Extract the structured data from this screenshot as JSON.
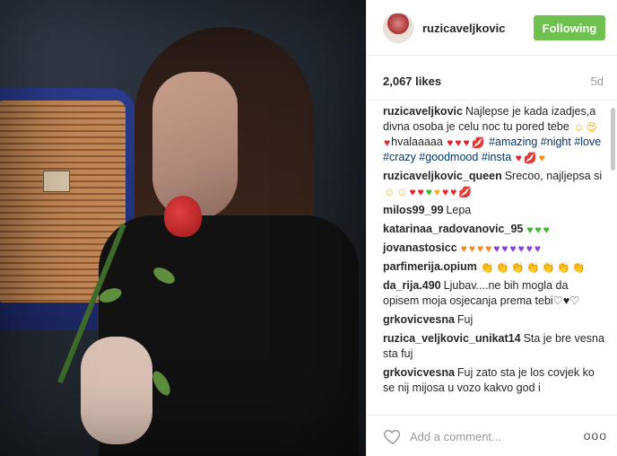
{
  "post": {
    "username": "ruzicaveljkovic",
    "follow_label": "Following",
    "likes": "2,067 likes",
    "age": "5d"
  },
  "comments": [
    {
      "user": "ruzicaveljkovic",
      "segments": [
        {
          "t": "text",
          "v": "Najlepse je kada izadjes,a divna osoba je celu noc tu pored tebe "
        },
        {
          "t": "emoji",
          "v": "☺",
          "c": "e-yellow"
        },
        {
          "t": "emoji",
          "v": "😍",
          "c": "e-yellow"
        },
        {
          "t": "emoji",
          "v": "♥",
          "c": "e-red"
        },
        {
          "t": "text",
          "v": "hvalaaaaa "
        },
        {
          "t": "emoji",
          "v": "♥",
          "c": "e-red"
        },
        {
          "t": "emoji",
          "v": "♥",
          "c": "e-red"
        },
        {
          "t": "emoji",
          "v": "♥",
          "c": "e-red"
        },
        {
          "t": "emoji",
          "v": "💋",
          "c": "e-red"
        },
        {
          "t": "tag",
          "v": " #amazing"
        },
        {
          "t": "tag",
          "v": " #night"
        },
        {
          "t": "tag",
          "v": " #love"
        },
        {
          "t": "tag",
          "v": " #crazy"
        },
        {
          "t": "tag",
          "v": " #goodmood"
        },
        {
          "t": "tag",
          "v": " #insta"
        },
        {
          "t": "text",
          "v": " "
        },
        {
          "t": "emoji",
          "v": "♥",
          "c": "e-red"
        },
        {
          "t": "emoji",
          "v": "💋",
          "c": "e-red"
        },
        {
          "t": "emoji",
          "v": "♥",
          "c": "e-orange"
        }
      ]
    },
    {
      "user": "ruzicaveljkovic_queen",
      "segments": [
        {
          "t": "text",
          "v": "Srecoo, najljepsa si"
        },
        {
          "t": "emoji",
          "v": "☺",
          "c": "e-yellow"
        },
        {
          "t": "emoji",
          "v": "☺",
          "c": "e-yellow"
        },
        {
          "t": "emoji",
          "v": "♥",
          "c": "e-red"
        },
        {
          "t": "emoji",
          "v": "♥",
          "c": "e-red"
        },
        {
          "t": "emoji",
          "v": "♥",
          "c": "e-green"
        },
        {
          "t": "emoji",
          "v": "♥",
          "c": "e-yellow"
        },
        {
          "t": "emoji",
          "v": "♥",
          "c": "e-red"
        },
        {
          "t": "emoji",
          "v": "♥",
          "c": "e-red"
        },
        {
          "t": "emoji",
          "v": "💋",
          "c": "e-red"
        }
      ]
    },
    {
      "user": "milos99_99",
      "segments": [
        {
          "t": "text",
          "v": "Lepa"
        }
      ]
    },
    {
      "user": "katarinaa_radovanovic_95",
      "segments": [
        {
          "t": "emoji",
          "v": "♥",
          "c": "e-green"
        },
        {
          "t": "emoji",
          "v": "♥",
          "c": "e-green"
        },
        {
          "t": "emoji",
          "v": "♥",
          "c": "e-green"
        }
      ]
    },
    {
      "user": "jovanastosicc",
      "segments": [
        {
          "t": "emoji",
          "v": "♥",
          "c": "e-orange"
        },
        {
          "t": "emoji",
          "v": "♥",
          "c": "e-orange"
        },
        {
          "t": "emoji",
          "v": "♥",
          "c": "e-orange"
        },
        {
          "t": "emoji",
          "v": "♥",
          "c": "e-orange"
        },
        {
          "t": "emoji",
          "v": "♥",
          "c": "e-purple"
        },
        {
          "t": "emoji",
          "v": "♥",
          "c": "e-purple"
        },
        {
          "t": "emoji",
          "v": "♥",
          "c": "e-purple"
        },
        {
          "t": "emoji",
          "v": "♥",
          "c": "e-purple"
        },
        {
          "t": "emoji",
          "v": "♥",
          "c": "e-purple"
        },
        {
          "t": "emoji",
          "v": "♥",
          "c": "e-purple"
        }
      ]
    },
    {
      "user": "parfimerija.opium",
      "segments": [
        {
          "t": "emoji",
          "v": "👏",
          "c": "e-yellow"
        },
        {
          "t": "emoji",
          "v": "👏",
          "c": "e-yellow"
        },
        {
          "t": "emoji",
          "v": "👏",
          "c": "e-yellow"
        },
        {
          "t": "emoji",
          "v": "👏",
          "c": "e-yellow"
        },
        {
          "t": "emoji",
          "v": "👏",
          "c": "e-yellow"
        },
        {
          "t": "emoji",
          "v": "👏",
          "c": "e-yellow"
        },
        {
          "t": "emoji",
          "v": "👏",
          "c": "e-yellow"
        }
      ]
    },
    {
      "user": "da_rija.490",
      "segments": [
        {
          "t": "text",
          "v": "Ljubav....ne bih mogla da opisem moja osjecanja prema tebi♡♥♡"
        }
      ]
    },
    {
      "user": "grkovicvesna",
      "segments": [
        {
          "t": "text",
          "v": "Fuj"
        }
      ]
    },
    {
      "user": "ruzica_veljkovic_unikat14",
      "segments": [
        {
          "t": "text",
          "v": "Sta je bre vesna sta fuj"
        }
      ]
    },
    {
      "user": "grkovicvesna",
      "segments": [
        {
          "t": "text",
          "v": "Fuj zato sta je los covjek ko se nij mijosa u vozo kakvo god i"
        }
      ]
    }
  ],
  "footer": {
    "add_comment_placeholder": "Add a comment...",
    "more_label": "ooo"
  }
}
